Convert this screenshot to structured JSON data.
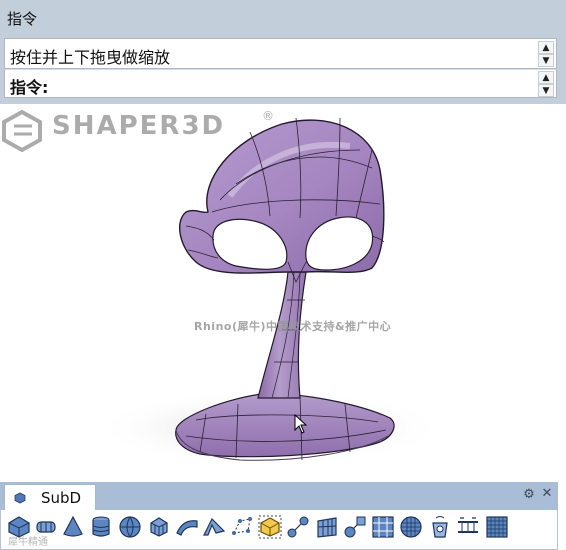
{
  "command_panel": {
    "title": "指令",
    "history_text": "按住并上下拖曳做缩放",
    "prompt": "指令:"
  },
  "viewport": {
    "model": "subd-chair",
    "model_color": "#a586c0",
    "watermark_brand": "SHAPER3D",
    "watermark_caption": "Rhino(犀牛)中国技术支持&推广中心"
  },
  "toolbar": {
    "tab_label": "SubD",
    "tools": [
      "subd-box-icon",
      "subd-cylinder-ring-icon",
      "subd-cone-icon",
      "subd-cylinder-icon",
      "subd-sphere-icon",
      "subd-cube-icon",
      "subd-patch-icon",
      "subd-fold-icon",
      "subd-control-points-icon",
      "subd-box-edit-icon",
      "subd-point-pair-icon",
      "subd-stripes-icon",
      "subd-sphere-link-icon",
      "subd-grid-panel-icon",
      "subd-globe-grid-icon",
      "subd-bucket-icon",
      "subd-bridge-icon",
      "subd-mesh-grid-icon"
    ]
  },
  "corner_watermark": "犀牛精通"
}
